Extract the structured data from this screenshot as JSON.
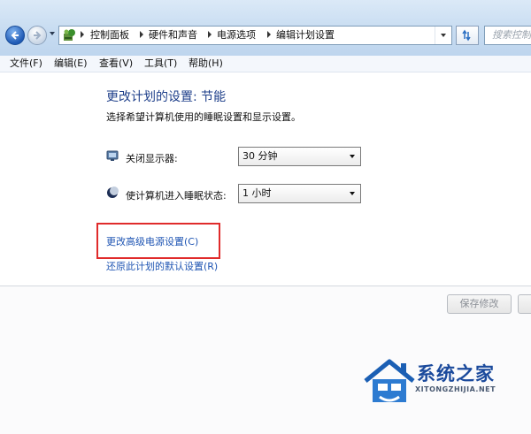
{
  "address_bar": {
    "breadcrumbs": [
      "控制面板",
      "硬件和声音",
      "电源选项",
      "编辑计划设置"
    ],
    "search_placeholder": "搜索控制…"
  },
  "menu": [
    "文件(F)",
    "编辑(E)",
    "查看(V)",
    "工具(T)",
    "帮助(H)"
  ],
  "content": {
    "title": "更改计划的设置: 节能",
    "subtitle": "选择希望计算机使用的睡眠设置和显示设置。",
    "options": [
      {
        "label": "关闭显示器:",
        "value": "30 分钟",
        "icon": "display-icon"
      },
      {
        "label": "使计算机进入睡眠状态:",
        "value": "1 小时",
        "icon": "moon-icon"
      }
    ],
    "links": {
      "advanced": "更改高级电源设置(C)",
      "restore": "还原此计划的默认设置(R)"
    }
  },
  "footer": {
    "save_label": "保存修改"
  },
  "watermark": {
    "text": "系统之家",
    "url": "XITONGZHIJIA.NET"
  },
  "colors": {
    "title": "#1e3f8a",
    "link": "#1f55b3",
    "highlight_box": "#e02b2b"
  }
}
